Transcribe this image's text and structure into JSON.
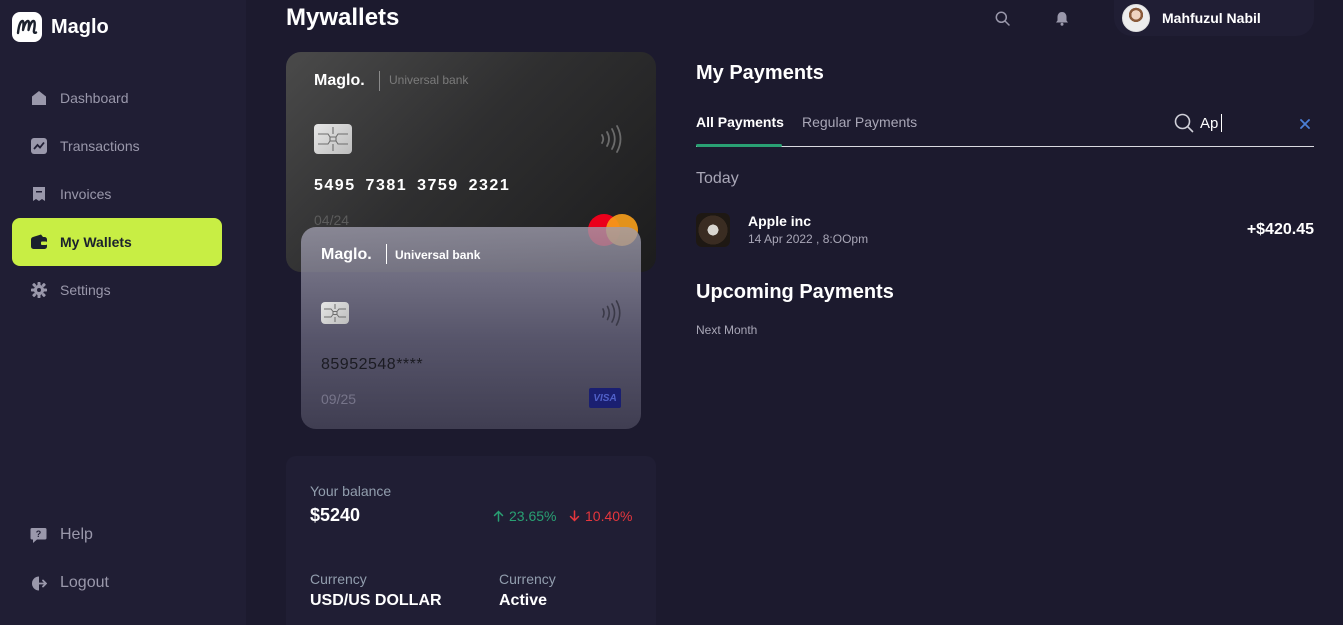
{
  "app": {
    "name": "Maglo",
    "page_title": "Mywallets",
    "accent_color": "#c8ee44"
  },
  "sidebar": {
    "items": [
      {
        "label": "Dashboard",
        "icon": "home-icon"
      },
      {
        "label": "Transactions",
        "icon": "chart-icon"
      },
      {
        "label": "Invoices",
        "icon": "invoice-icon"
      },
      {
        "label": "My Wallets",
        "icon": "wallet-icon",
        "active": true
      },
      {
        "label": "Settings",
        "icon": "gear-icon"
      }
    ],
    "bottom_items": [
      {
        "label": "Help",
        "icon": "help-icon"
      },
      {
        "label": "Logout",
        "icon": "logout-icon"
      }
    ]
  },
  "header": {
    "user_name": "Mahfuzul Nabil",
    "icons": [
      "search-icon",
      "bell-icon"
    ]
  },
  "cards": {
    "primary": {
      "brand": "Maglo.",
      "bank": "Universal bank",
      "number": "5495 7381 3759 2321",
      "expiry": "04/24",
      "network": "mastercard"
    },
    "secondary": {
      "brand": "Maglo.",
      "bank": "Universal bank",
      "number": "85952548****",
      "expiry": "09/25",
      "network": "VISA"
    }
  },
  "balance": {
    "label": "Your balance",
    "value": "$5240",
    "up_percent": "23.65%",
    "down_percent": "10.40%",
    "up_color": "#29a073",
    "down_color": "#e5363d",
    "currency_label": "Currency",
    "currency_value": "USD/US DOLLAR",
    "status_label": "Currency",
    "status_value": "Active"
  },
  "payments": {
    "title": "My Payments",
    "tabs": [
      {
        "label": "All Payments",
        "active": true
      },
      {
        "label": "Regular Payments",
        "active": false
      }
    ],
    "search": {
      "value": "Ap",
      "placeholder": ""
    },
    "today_label": "Today",
    "today_items": [
      {
        "merchant": "Apple inc",
        "date": "14 Apr 2022 , 8:OOpm",
        "amount": "+$420.45"
      }
    ],
    "upcoming_title": "Upcoming Payments",
    "upcoming_subtitle": "Next Month"
  }
}
